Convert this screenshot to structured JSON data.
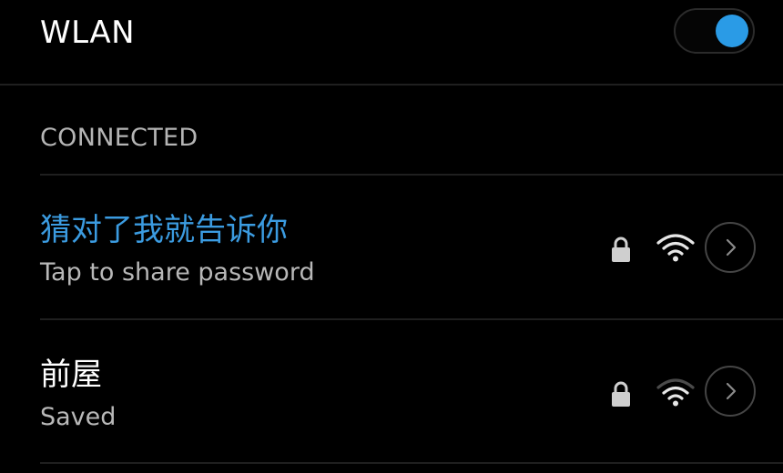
{
  "header": {
    "title": "WLAN",
    "toggle_state": "on",
    "toggle_color": "#2a9be6"
  },
  "sections": {
    "connected_label": "CONNECTED"
  },
  "networks": [
    {
      "name": "猜对了我就告诉你",
      "status": "Tap to share password",
      "name_color": "#3b9be0",
      "secured_icon": "lock-icon",
      "signal_icon": "wifi-icon",
      "signal_level": "full",
      "detail_icon": "chevron-right-icon"
    },
    {
      "name": "前屋",
      "status": "Saved",
      "name_color": "#ffffff",
      "secured_icon": "lock-icon",
      "signal_icon": "wifi-icon",
      "signal_level": "weak",
      "detail_icon": "chevron-right-icon"
    }
  ]
}
